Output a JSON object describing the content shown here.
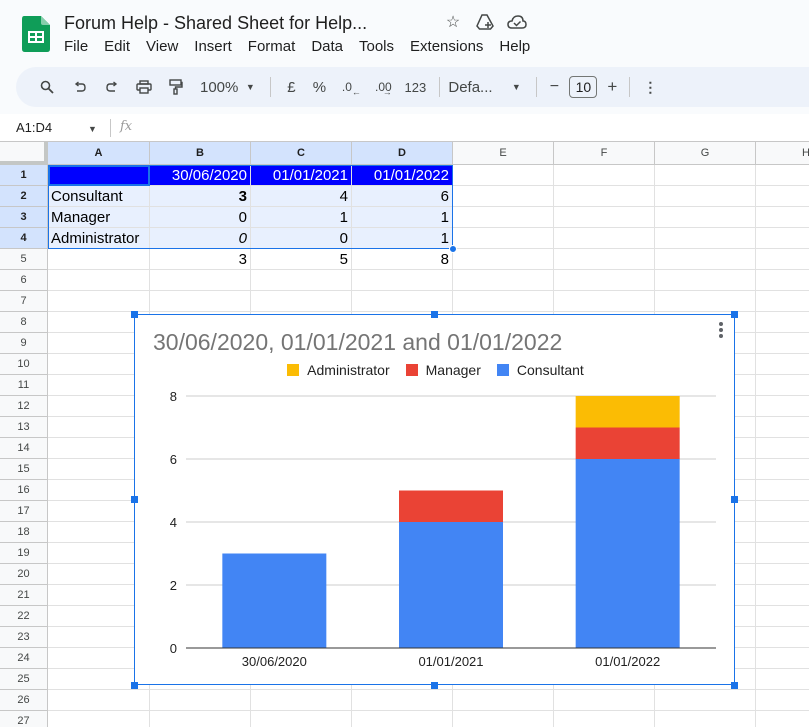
{
  "app": {
    "title": "Forum Help - Shared Sheet for Help...",
    "icons": [
      "star-icon",
      "move-to-drive-icon",
      "cloud-saved-icon"
    ]
  },
  "menu": [
    "File",
    "Edit",
    "View",
    "Insert",
    "Format",
    "Data",
    "Tools",
    "Extensions",
    "Help"
  ],
  "toolbar": {
    "zoom": "100%",
    "currency": "£",
    "percent": "%",
    "decrease_decimal": ".0",
    "increase_decimal": ".00",
    "number_format": "123",
    "font": "Defa...",
    "font_size": "10",
    "minus": "−",
    "plus": "+"
  },
  "formula_bar": {
    "name_box": "A1:D4",
    "fx_label": "fx",
    "value": ""
  },
  "grid": {
    "columns": [
      "A",
      "B",
      "C",
      "D",
      "E",
      "F",
      "G",
      "H"
    ],
    "rows": [
      "1",
      "2",
      "3",
      "4",
      "5",
      "6",
      "7",
      "8",
      "9",
      "10",
      "11",
      "12",
      "13",
      "14",
      "15",
      "16",
      "17",
      "18",
      "19",
      "20",
      "21",
      "22",
      "23",
      "24",
      "25",
      "26",
      "27"
    ],
    "cells": {
      "r1": [
        "",
        "30/06/2020",
        "01/01/2021",
        "01/01/2022"
      ],
      "r2": [
        "Consultant",
        "3",
        "4",
        "6"
      ],
      "r3": [
        "Manager",
        "0",
        "1",
        "1"
      ],
      "r4": [
        "Administrator",
        "0",
        "0",
        "1"
      ],
      "r5": [
        "",
        "3",
        "5",
        "8"
      ]
    }
  },
  "chart_data": {
    "type": "bar",
    "stacked": true,
    "title": "30/06/2020, 01/01/2021 and 01/01/2022",
    "categories": [
      "30/06/2020",
      "01/01/2021",
      "01/01/2022"
    ],
    "series": [
      {
        "name": "Consultant",
        "values": [
          3,
          4,
          6
        ],
        "color": "#4285f4"
      },
      {
        "name": "Manager",
        "values": [
          0,
          1,
          1
        ],
        "color": "#ea4335"
      },
      {
        "name": "Administrator",
        "values": [
          0,
          0,
          1
        ],
        "color": "#fbbc04"
      }
    ],
    "legend": [
      "Administrator",
      "Manager",
      "Consultant"
    ],
    "legend_position": "top",
    "xlabel": "",
    "ylabel": "",
    "ylim": [
      0,
      8
    ],
    "yticks": [
      "0",
      "2",
      "4",
      "6",
      "8"
    ],
    "grid": true
  }
}
